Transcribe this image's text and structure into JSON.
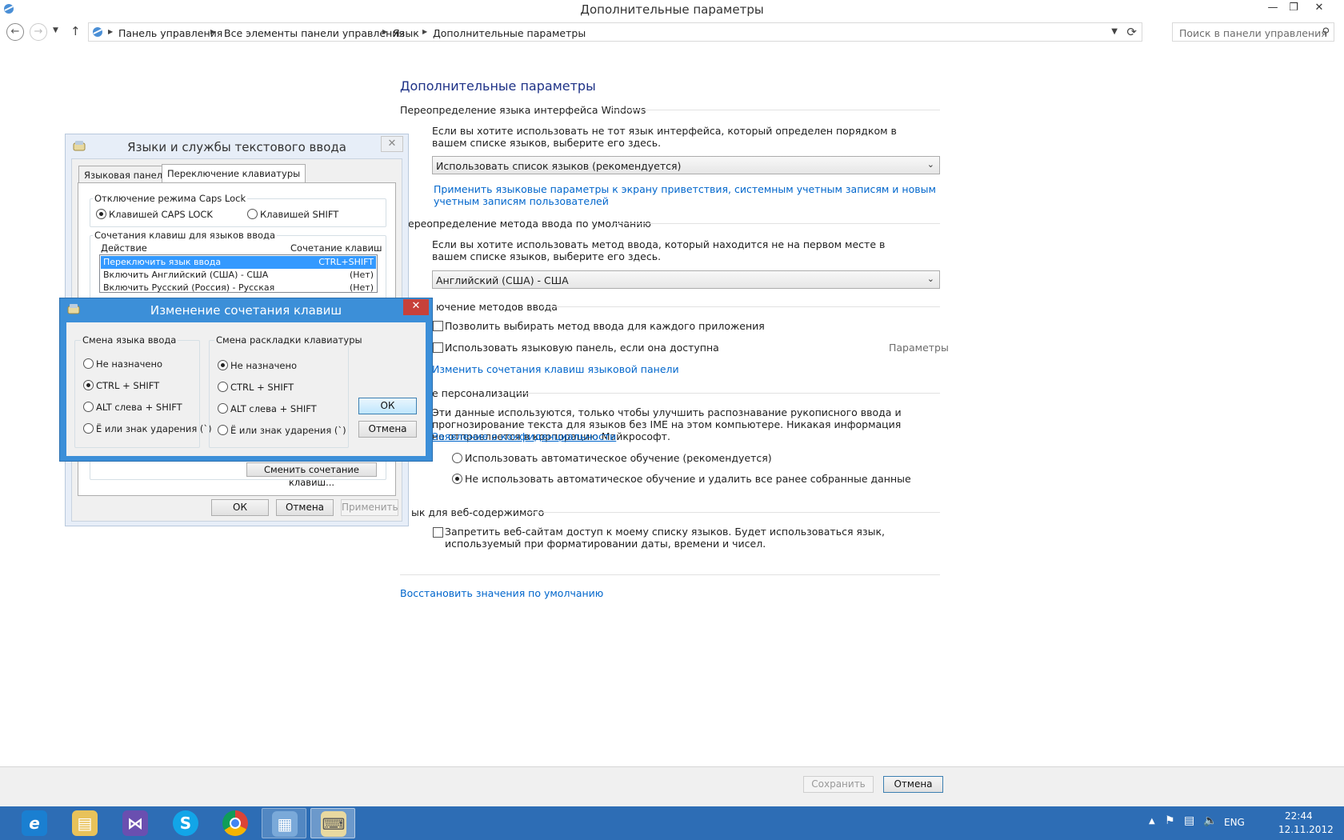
{
  "window": {
    "title": "Дополнительные параметры"
  },
  "address": {
    "crumbs": [
      "Панель управления",
      "Все элементы панели управления",
      "Язык",
      "Дополнительные параметры"
    ],
    "search_placeholder": "Поиск в панели управления"
  },
  "main": {
    "heading": "Дополнительные параметры",
    "s1": {
      "title": "Переопределение языка интерфейса Windows",
      "desc": "Если вы хотите использовать не тот язык интерфейса, который определен порядком в вашем списке языков, выберите его здесь.",
      "select": "Использовать список языков (рекомендуется)",
      "link": "Применить языковые параметры к экрану приветствия, системным учетным записям и новым учетным записям пользователей"
    },
    "s2": {
      "title": "ереопределение метода ввода по умолчанию",
      "desc": "Если вы хотите использовать метод ввода, который находится не на первом месте в вашем списке языков, выберите его здесь.",
      "select": "Английский (США) - США"
    },
    "s3": {
      "title": "ючение методов ввода",
      "cb1": "Позволить выбирать метод ввода для каждого приложения",
      "cb2": "Использовать языковую панель, если она доступна",
      "params": "Параметры",
      "link": "Изменить сочетания клавиш языковой панели"
    },
    "s4": {
      "title": "е персонализации",
      "desc": "Эти данные используются, только чтобы улучшить распознавание рукописного ввода и прогнозирование текста для языков без IME на этом компьютере. Никакая информация не отправляется в корпорацию Майкрософт.",
      "link": "Заявление о конфиденциальности",
      "r1": "Использовать автоматическое обучение (рекомендуется)",
      "r2": "Не использовать автоматическое обучение и удалить все ранее собранные данные"
    },
    "s5": {
      "title": "ык для веб-содержимого",
      "cb": "Запретить веб-сайтам доступ к моему списку языков. Будет использоваться язык, используемый при форматировании даты, времени и чисел."
    },
    "restore_link": "Восстановить значения по умолчанию"
  },
  "footer": {
    "save": "Сохранить",
    "cancel": "Отмена"
  },
  "dlg1": {
    "title": "Языки и службы текстового ввода",
    "tab1": "Языковая панель",
    "tab2": "Переключение клавиатуры",
    "caps_group": "Отключение режима Caps Lock",
    "caps_r1": "Клавишей CAPS LOCK",
    "caps_r2": "Клавишей SHIFT",
    "hk_group": "Сочетания клавиш для языков ввода",
    "col_action": "Действие",
    "col_keys": "Сочетание клавиш",
    "rows": [
      {
        "action": "Переключить язык ввода",
        "keys": "CTRL+SHIFT"
      },
      {
        "action": "Включить Английский (США) - США",
        "keys": "(Нет)"
      },
      {
        "action": "Включить Русский (Россия) - Русская",
        "keys": "(Нет)"
      }
    ],
    "change_btn": "Сменить сочетание клавиш...",
    "ok": "ОК",
    "cancel": "Отмена",
    "apply": "Применить"
  },
  "dlg2": {
    "title": "Изменение сочетания клавиш",
    "g1": "Смена языка ввода",
    "g1_opts": [
      "Не назначено",
      "CTRL + SHIFT",
      "ALT слева + SHIFT",
      "Ё или знак ударения (`)"
    ],
    "g2": "Смена раскладки клавиатуры",
    "g2_opts": [
      "Не назначено",
      "CTRL + SHIFT",
      "ALT слева + SHIFT",
      "Ё или знак ударения (`)"
    ],
    "ok": "ОК",
    "cancel": "Отмена"
  },
  "tray": {
    "lang": "ENG",
    "time": "22:44",
    "date": "12.11.2012"
  },
  "colors": {
    "accent": "#1e3287",
    "link": "#0066cc",
    "taskbar": "#2d6db5",
    "selection": "#3399ff"
  }
}
